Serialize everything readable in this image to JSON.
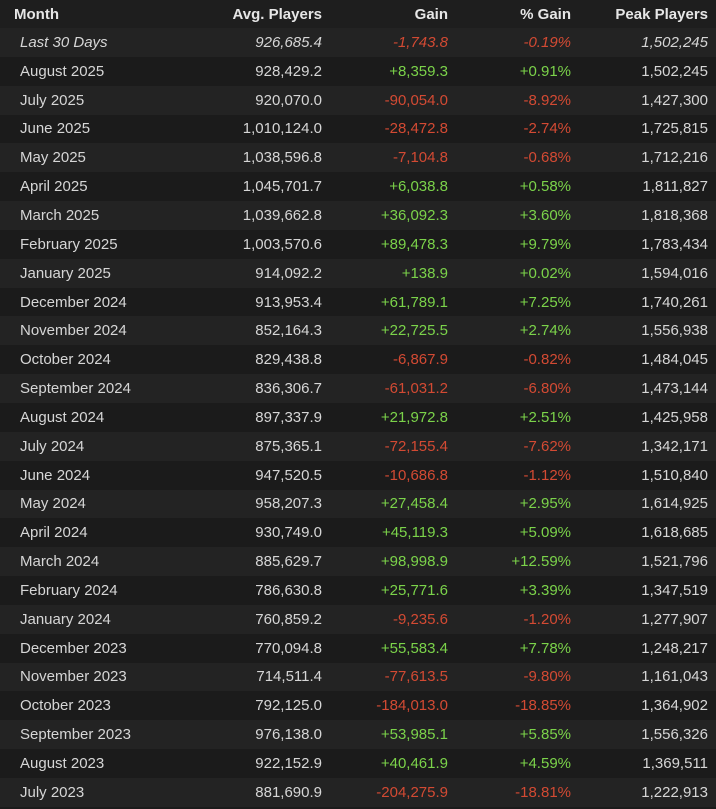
{
  "header": {
    "month": "Month",
    "avg": "Avg. Players",
    "gain": "Gain",
    "pct": "% Gain",
    "peak": "Peak Players"
  },
  "colors": {
    "positive": "#7bd34a",
    "negative": "#d34a33"
  },
  "rows": [
    {
      "month": "Last 30 Days",
      "avg": "926,685.4",
      "gain": "-1,743.8",
      "pct": "-0.19%",
      "peak": "1,502,245"
    },
    {
      "month": "August 2025",
      "avg": "928,429.2",
      "gain": "+8,359.3",
      "pct": "+0.91%",
      "peak": "1,502,245"
    },
    {
      "month": "July 2025",
      "avg": "920,070.0",
      "gain": "-90,054.0",
      "pct": "-8.92%",
      "peak": "1,427,300"
    },
    {
      "month": "June 2025",
      "avg": "1,010,124.0",
      "gain": "-28,472.8",
      "pct": "-2.74%",
      "peak": "1,725,815"
    },
    {
      "month": "May 2025",
      "avg": "1,038,596.8",
      "gain": "-7,104.8",
      "pct": "-0.68%",
      "peak": "1,712,216"
    },
    {
      "month": "April 2025",
      "avg": "1,045,701.7",
      "gain": "+6,038.8",
      "pct": "+0.58%",
      "peak": "1,811,827"
    },
    {
      "month": "March 2025",
      "avg": "1,039,662.8",
      "gain": "+36,092.3",
      "pct": "+3.60%",
      "peak": "1,818,368"
    },
    {
      "month": "February 2025",
      "avg": "1,003,570.6",
      "gain": "+89,478.3",
      "pct": "+9.79%",
      "peak": "1,783,434"
    },
    {
      "month": "January 2025",
      "avg": "914,092.2",
      "gain": "+138.9",
      "pct": "+0.02%",
      "peak": "1,594,016"
    },
    {
      "month": "December 2024",
      "avg": "913,953.4",
      "gain": "+61,789.1",
      "pct": "+7.25%",
      "peak": "1,740,261"
    },
    {
      "month": "November 2024",
      "avg": "852,164.3",
      "gain": "+22,725.5",
      "pct": "+2.74%",
      "peak": "1,556,938"
    },
    {
      "month": "October 2024",
      "avg": "829,438.8",
      "gain": "-6,867.9",
      "pct": "-0.82%",
      "peak": "1,484,045"
    },
    {
      "month": "September 2024",
      "avg": "836,306.7",
      "gain": "-61,031.2",
      "pct": "-6.80%",
      "peak": "1,473,144"
    },
    {
      "month": "August 2024",
      "avg": "897,337.9",
      "gain": "+21,972.8",
      "pct": "+2.51%",
      "peak": "1,425,958"
    },
    {
      "month": "July 2024",
      "avg": "875,365.1",
      "gain": "-72,155.4",
      "pct": "-7.62%",
      "peak": "1,342,171"
    },
    {
      "month": "June 2024",
      "avg": "947,520.5",
      "gain": "-10,686.8",
      "pct": "-1.12%",
      "peak": "1,510,840"
    },
    {
      "month": "May 2024",
      "avg": "958,207.3",
      "gain": "+27,458.4",
      "pct": "+2.95%",
      "peak": "1,614,925"
    },
    {
      "month": "April 2024",
      "avg": "930,749.0",
      "gain": "+45,119.3",
      "pct": "+5.09%",
      "peak": "1,618,685"
    },
    {
      "month": "March 2024",
      "avg": "885,629.7",
      "gain": "+98,998.9",
      "pct": "+12.59%",
      "peak": "1,521,796"
    },
    {
      "month": "February 2024",
      "avg": "786,630.8",
      "gain": "+25,771.6",
      "pct": "+3.39%",
      "peak": "1,347,519"
    },
    {
      "month": "January 2024",
      "avg": "760,859.2",
      "gain": "-9,235.6",
      "pct": "-1.20%",
      "peak": "1,277,907"
    },
    {
      "month": "December 2023",
      "avg": "770,094.8",
      "gain": "+55,583.4",
      "pct": "+7.78%",
      "peak": "1,248,217"
    },
    {
      "month": "November 2023",
      "avg": "714,511.4",
      "gain": "-77,613.5",
      "pct": "-9.80%",
      "peak": "1,161,043"
    },
    {
      "month": "October 2023",
      "avg": "792,125.0",
      "gain": "-184,013.0",
      "pct": "-18.85%",
      "peak": "1,364,902"
    },
    {
      "month": "September 2023",
      "avg": "976,138.0",
      "gain": "+53,985.1",
      "pct": "+5.85%",
      "peak": "1,556,326"
    },
    {
      "month": "August 2023",
      "avg": "922,152.9",
      "gain": "+40,461.9",
      "pct": "+4.59%",
      "peak": "1,369,511"
    },
    {
      "month": "July 2023",
      "avg": "881,690.9",
      "gain": "-204,275.9",
      "pct": "-18.81%",
      "peak": "1,222,913"
    }
  ]
}
